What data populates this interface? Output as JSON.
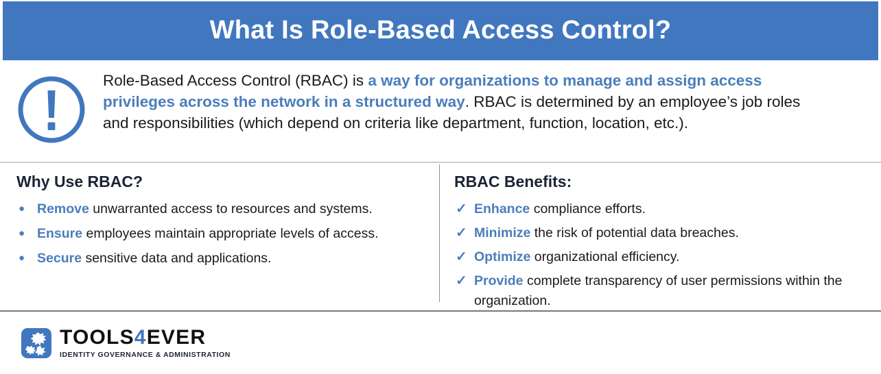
{
  "header": {
    "title": "What Is Role-Based Access Control?"
  },
  "intro": {
    "icon": "exclamation-circle-icon",
    "part1": "Role-Based Access Control (RBAC) is ",
    "highlight": "a way for organizations to manage and assign access privileges across the network in a structured way",
    "part2": ". RBAC is determined by an employee’s job roles and responsibilities (which depend on criteria like department, function, location, etc.)."
  },
  "left_column": {
    "heading": "Why Use RBAC?",
    "bullet_glyph": "●",
    "items": [
      {
        "lead": "Remove",
        "rest": " unwarranted access to resources and systems."
      },
      {
        "lead": "Ensure",
        "rest": " employees maintain appropriate levels of access."
      },
      {
        "lead": "Secure",
        "rest": " sensitive data and applications."
      }
    ]
  },
  "right_column": {
    "heading": "RBAC Benefits:",
    "check_glyph": "✓",
    "items": [
      {
        "lead": "Enhance",
        "rest": " compliance efforts."
      },
      {
        "lead": "Minimize",
        "rest": " the risk of potential data breaches."
      },
      {
        "lead": "Optimize",
        "rest": " organizational efficiency."
      },
      {
        "lead": "Provide",
        "rest": " complete transparency of user permissions within the organization."
      }
    ]
  },
  "footer": {
    "logo_mark": "tools4ever-logo-mark",
    "brand_part1": "TOOLS",
    "brand_accent": "4",
    "brand_part2": "EVER",
    "tagline": "IDENTITY GOVERNANCE & ADMINISTRATION"
  },
  "colors": {
    "brand_blue": "#4177bf",
    "text_blue": "#4a7ebb",
    "heading_navy": "#1b2433",
    "divider_light": "#c6cdd4",
    "divider_dark": "#6e7a84"
  }
}
